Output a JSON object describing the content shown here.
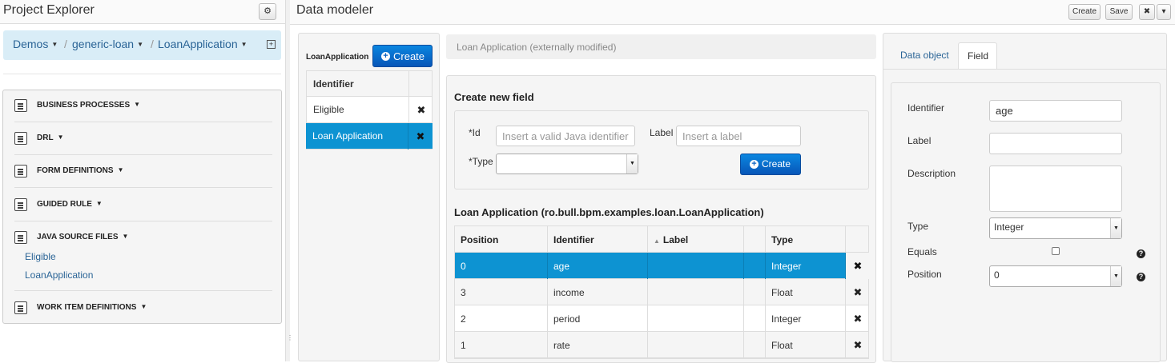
{
  "project_explorer": {
    "title": "Project Explorer",
    "breadcrumb": [
      "Demos",
      "generic-loan",
      "LoanApplication"
    ],
    "categories": [
      {
        "label": "BUSINESS PROCESSES",
        "icon": "business-process-icon"
      },
      {
        "label": "DRL",
        "icon": "drl-file-icon"
      },
      {
        "label": "FORM DEFINITIONS",
        "icon": "form-definition-icon"
      },
      {
        "label": "GUIDED RULE",
        "icon": "guided-rule-icon"
      },
      {
        "label": "JAVA SOURCE FILES",
        "icon": "java-source-icon"
      },
      {
        "label": "WORK ITEM DEFINITIONS",
        "icon": "work-item-icon"
      }
    ],
    "java_files": [
      "Eligible",
      "LoanApplication"
    ]
  },
  "data_modeler": {
    "title": "Data modeler",
    "header_buttons": {
      "create": "Create",
      "save": "Save",
      "close": "✖",
      "menu": "▾"
    }
  },
  "object_list": {
    "title": "LoanApplication",
    "create_label": "Create",
    "header": "Identifier",
    "items": [
      {
        "name": "Eligible",
        "selected": false
      },
      {
        "name": "Loan Application",
        "selected": true
      }
    ]
  },
  "center": {
    "status_text": "Loan Application (externally modified)",
    "create_field": {
      "title": "Create new field",
      "id_label": "*Id",
      "id_placeholder": "Insert a valid Java identifier",
      "label_label": "Label",
      "label_placeholder": "Insert a label",
      "type_label": "*Type",
      "type_value": "",
      "create_label": "Create"
    },
    "fields_title": "Loan Application (ro.bull.bpm.examples.loan.LoanApplication)",
    "columns": {
      "position": "Position",
      "identifier": "Identifier",
      "label": "Label",
      "type": "Type"
    },
    "sort_indicator": "▲",
    "rows": [
      {
        "position": "0",
        "identifier": "age",
        "label": "",
        "type": "Integer",
        "selected": true
      },
      {
        "position": "3",
        "identifier": "income",
        "label": "",
        "type": "Float",
        "selected": false
      },
      {
        "position": "2",
        "identifier": "period",
        "label": "",
        "type": "Integer",
        "selected": false
      },
      {
        "position": "1",
        "identifier": "rate",
        "label": "",
        "type": "Float",
        "selected": false
      }
    ]
  },
  "properties": {
    "tabs": [
      "Data object",
      "Field"
    ],
    "active_tab": "Field",
    "identifier_label": "Identifier",
    "identifier_value": "age",
    "label_label": "Label",
    "label_value": "",
    "description_label": "Description",
    "description_value": "",
    "type_label": "Type",
    "type_value": "Integer",
    "equals_label": "Equals",
    "equals_checked": false,
    "position_label": "Position",
    "position_value": "0"
  },
  "colors": {
    "selection": "#0d93d2",
    "primary_button": "#0856b8",
    "breadcrumb_bg": "#d9edf7",
    "link": "#2a6496"
  }
}
